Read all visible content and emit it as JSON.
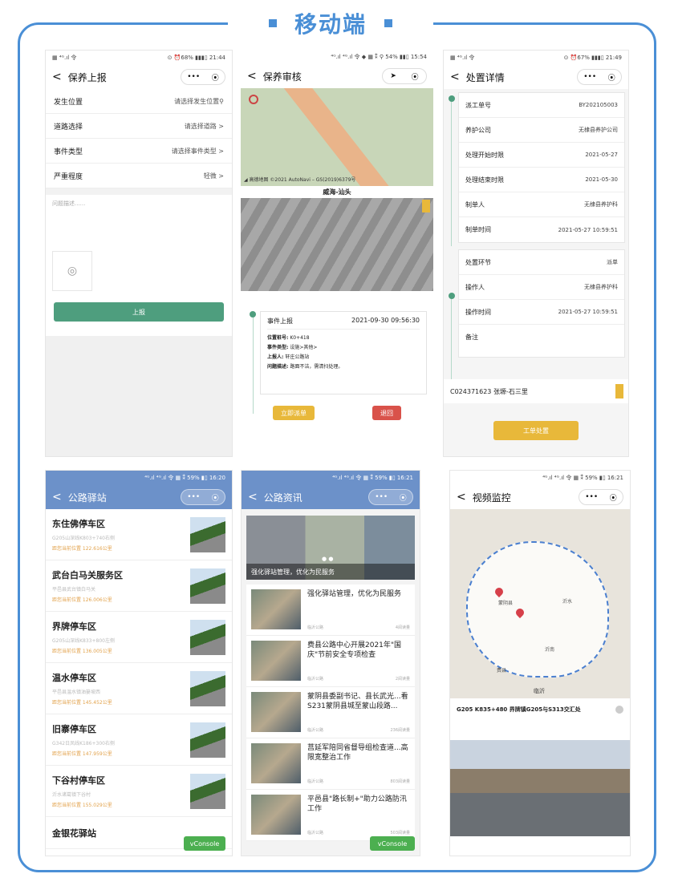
{
  "page_title": "移动端",
  "common": {
    "more": "•••",
    "target": "⦿"
  },
  "p1": {
    "status_left": "▦ ⁴ᴳ.ıl 令",
    "status_right": "⊙ ⏰68% ▮▮▮▯ 21:44",
    "title": "保养上报",
    "fields": [
      {
        "label": "发生位置",
        "value": "请选择发生位置⚲"
      },
      {
        "label": "道路选择",
        "value": "请选择道路 >"
      },
      {
        "label": "事件类型",
        "value": "请选择事件类型 >"
      },
      {
        "label": "严重程度",
        "value": "轻微 >"
      }
    ],
    "desc_placeholder": "问题描述......",
    "submit": "上报"
  },
  "p2": {
    "status": "⁴ᴳ.ıl ⁴ᴳ.ıl 令 ◆ ▦ ⁑ ⚲ 54% ▮▮▯ 15:54",
    "title": "保养审核",
    "map_copyright": "◢ 高德地图 ©2021 AutoNavi – GS(2019)6379号",
    "section": "威海-汕头",
    "card_title": "事件上报",
    "card_time": "2021-09-30 09:56:30",
    "details": [
      {
        "k": "位置桩号:",
        "v": "K0+418"
      },
      {
        "k": "事件类型:",
        "v": "设施>其他>"
      },
      {
        "k": "上报人:",
        "v": "轩庄公路站"
      },
      {
        "k": "问题描述:",
        "v": "路面不洁，需清扫处理。"
      }
    ],
    "btn_ok": "立即派单",
    "btn_back": "退回"
  },
  "p3": {
    "status_left": "▦ ⁴ᴳ.ıl 令",
    "status_right": "⊙ ⏰67% ▮▮▮▯ 21:49",
    "title": "处置详情",
    "group1": [
      {
        "k": "派工单号",
        "v": "BY202105003"
      },
      {
        "k": "养护公司",
        "v": "无棣县养护公司"
      },
      {
        "k": "处理开始时限",
        "v": "2021-05-27"
      },
      {
        "k": "处理结束时限",
        "v": "2021-05-30"
      },
      {
        "k": "制单人",
        "v": "无棣县养护科"
      },
      {
        "k": "制单时间",
        "v": "2021-05-27 10:59:51"
      }
    ],
    "group2": [
      {
        "k": "处置环节",
        "v": "派单"
      },
      {
        "k": "操作人",
        "v": "无棣县养护科"
      },
      {
        "k": "操作时间",
        "v": "2021-05-27 10:59:51"
      },
      {
        "k": "备注",
        "v": ""
      }
    ],
    "bottom_info": "C024371623 张塬-石三里",
    "dispose_btn": "工单处置"
  },
  "p4": {
    "status": "⁴ᴳ.ıl ⁴ᴳ.ıl 令   ▦ ⁑ 59% ▮▯ 16:20",
    "title": "公路驿站",
    "items": [
      {
        "name": "东住佛停车区",
        "sub": "G205山深线K803+740右侧",
        "loc": "距您当前位置 122.616公里"
      },
      {
        "name": "武台白马关服务区",
        "sub": "平邑县武台镇白马关",
        "loc": "距您当前位置 126.006公里"
      },
      {
        "name": "界牌停车区",
        "sub": "G205山深线K833+800左侧",
        "loc": "距您当前位置 136.005公里"
      },
      {
        "name": "温水停车区",
        "sub": "平邑县温水镇油篓坡西",
        "loc": "距您当前位置 145.452公里"
      },
      {
        "name": "旧寨停车区",
        "sub": "G342日凤线K186+300右侧",
        "loc": "距您当前位置 147.959公里"
      },
      {
        "name": "下谷村停车区",
        "sub": "沂水诸葛镇下谷村",
        "loc": "距您当前位置 155.029公里"
      },
      {
        "name": "金银花驿站",
        "sub": "",
        "loc": ""
      }
    ],
    "vconsole": "vConsole"
  },
  "p5": {
    "status": "⁴ᴳ.ıl ⁴ᴳ.ıl 令   ▦ ⁑ 59% ▮▯ 16:21",
    "title": "公路资讯",
    "banner_text": "强化驿站管理，优化为民服务",
    "news": [
      {
        "title": "强化驿站管理，优化为民服务",
        "src": "临沂公路",
        "reads": "4阅读量"
      },
      {
        "title": "费县公路中心开展2021年\"国庆\"节前安全专项检查",
        "src": "临沂公路",
        "reads": "2阅读量"
      },
      {
        "title": "蒙阴县委副书记、县长武光...看S231蒙阴县城至蒙山段路...",
        "src": "临沂公路",
        "reads": "236阅读量"
      },
      {
        "title": "莒延军陪同省督导组检查道...高限宽整治工作",
        "src": "临沂公路",
        "reads": "803阅读量"
      },
      {
        "title": "平邑县\"路长制+\"助力公路防汛工作",
        "src": "临沂公路",
        "reads": "503阅读量"
      }
    ],
    "vconsole": "vConsole"
  },
  "p6": {
    "status": "⁴ᴳ.ıl ⁴ᴳ.ıl 令   ▦ ⁑ 59% ▮▯ 16:21",
    "title": "视频监控",
    "map_labels": [
      "蒙阴县",
      "沂水",
      "沂南",
      "临沂",
      "费县"
    ],
    "camera_label": "G205 K835+480 界牌镇G205与S313交汇处"
  }
}
